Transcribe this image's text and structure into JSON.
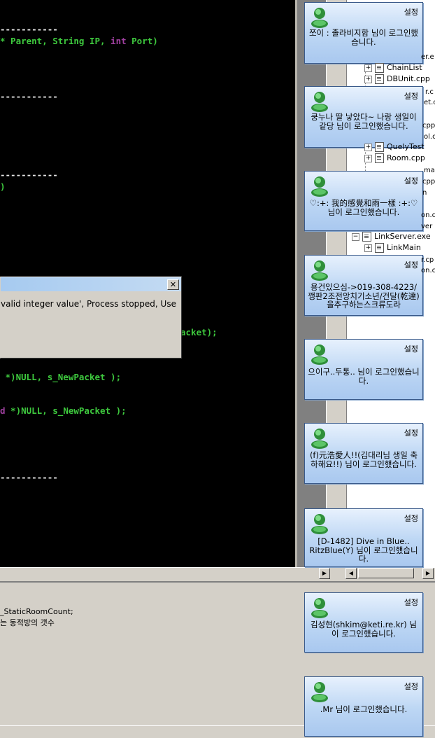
{
  "editor": {
    "lines": [
      {
        "segments": [
          {
            "t": "-----------",
            "c": "white"
          }
        ]
      },
      {
        "segments": [
          {
            "t": "* Parent, String IP, ",
            "c": "green"
          },
          {
            "t": "int",
            "c": "purple"
          },
          {
            "t": " Port)",
            "c": "green"
          }
        ]
      },
      {
        "segments": [
          {
            "t": "-----------",
            "c": "white"
          }
        ]
      },
      {
        "segments": [
          {
            "t": "-----------",
            "c": "white"
          }
        ]
      },
      {
        "segments": [
          {
            "t": ")",
            "c": "green"
          }
        ]
      },
      {
        "segments": [
          {
            "t": "acket);",
            "c": "green"
          }
        ]
      },
      {
        "segments": [
          {
            "t": " *)NULL, s_NewPacket );",
            "c": "green"
          }
        ]
      },
      {
        "segments": [
          {
            "t": "d",
            "c": "purple"
          },
          {
            "t": " *)NULL, s_NewPacket );",
            "c": "green"
          }
        ]
      },
      {
        "segments": [
          {
            "t": "-----------",
            "c": "white"
          }
        ]
      }
    ]
  },
  "tree": {
    "items": [
      {
        "label": "ChainList",
        "toggle": "+",
        "type": "file"
      },
      {
        "label": "DBUnit.cpp",
        "toggle": "+",
        "type": "file"
      },
      {
        "label": "QuelyTest",
        "toggle": "+",
        "type": "file"
      },
      {
        "label": "Room.cpp",
        "toggle": "+",
        "type": "file"
      },
      {
        "label": "LinkServer.exe",
        "toggle": "−",
        "type": "exe"
      },
      {
        "label": "LinkMain",
        "toggle": "+",
        "type": "file"
      }
    ],
    "fragments": [
      "er.e",
      "r.c",
      "et.c",
      "cpp",
      "ol.c",
      "ma",
      "cpp",
      "n",
      "on.c",
      "ver",
      "r.cp",
      "on.c"
    ]
  },
  "error_dialog": {
    "close_label": "✕",
    "message_line1": "valid integer value', Process stopped, Use",
    "message_line2": ""
  },
  "output": {
    "lines": [
      "_StaticRoomCount;",
      "는 동적방의 갯수"
    ]
  },
  "toasts": [
    {
      "settings": "설정",
      "message": "쪼이 : 졸라비지함 님이 로그인했습니다."
    },
    {
      "settings": "설정",
      "message": "쿵누나 딸 낳았다~ 나랑 생일이 같당 님이 로그인했습니다."
    },
    {
      "settings": "설정",
      "message": "♡:+: 我的感覺和雨一樣 :+:♡ 님이 로그인했습니다."
    },
    {
      "settings": "설정",
      "message": "용건있으심->019-308-4223/깽판2조전앙치기소년/건달(乾達)을추구하는스크류도라"
    },
    {
      "settings": "설정",
      "message": "으이구..두통.. 님이 로그인했습니다."
    },
    {
      "settings": "설정",
      "message": "(f)元浩愛人!!(김대리님 생일 축하해요!!) 님이 로그인했습니다."
    },
    {
      "settings": "설정",
      "message": "[D-1482] Dive in Blue.. RitzBlue(Y) 님이 로그인했습니다."
    },
    {
      "settings": "설정",
      "message": "김성현(shkim@keti.re.kr) 님이 로그인했습니다."
    },
    {
      "settings": "설정",
      "message": ".Mr 님이 로그인했습니다."
    }
  ],
  "colors": {
    "toast_top": "#e7f1fd",
    "toast_bottom": "#a9c8ef",
    "editor_bg": "#000000",
    "code_green": "#3ec93e",
    "code_purple": "#a040a0"
  }
}
